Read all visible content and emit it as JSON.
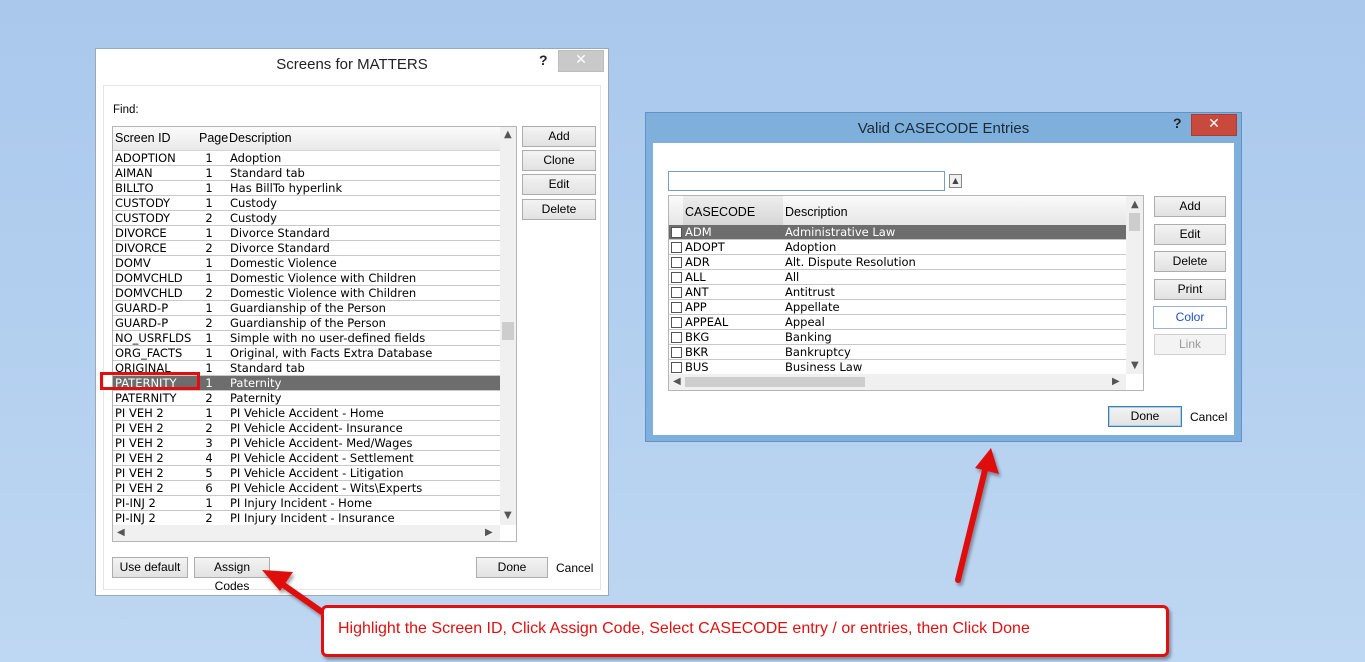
{
  "screens_dialog": {
    "title": "Screens for MATTERS",
    "help": "?",
    "close": "✕",
    "find_label": "Find:",
    "columns": [
      "Screen ID",
      "Page",
      "Description"
    ],
    "rows": [
      {
        "id": "ADOPTION",
        "page": "1",
        "desc": "Adoption"
      },
      {
        "id": "AIMAN",
        "page": "1",
        "desc": "Standard tab"
      },
      {
        "id": "BILLTO",
        "page": "1",
        "desc": "Has BillTo hyperlink"
      },
      {
        "id": "CUSTODY",
        "page": "1",
        "desc": "Custody"
      },
      {
        "id": "CUSTODY",
        "page": "2",
        "desc": "Custody"
      },
      {
        "id": "DIVORCE",
        "page": "1",
        "desc": "Divorce Standard"
      },
      {
        "id": "DIVORCE",
        "page": "2",
        "desc": "Divorce Standard"
      },
      {
        "id": "DOMV",
        "page": "1",
        "desc": "Domestic Violence"
      },
      {
        "id": "DOMVCHLD",
        "page": "1",
        "desc": "Domestic Violence with Children"
      },
      {
        "id": "DOMVCHLD",
        "page": "2",
        "desc": "Domestic Violence with Children"
      },
      {
        "id": "GUARD-P",
        "page": "1",
        "desc": "Guardianship of the Person"
      },
      {
        "id": "GUARD-P",
        "page": "2",
        "desc": "Guardianship of the Person"
      },
      {
        "id": "NO_USRFLDS",
        "page": "1",
        "desc": "Simple with no user-defined fields"
      },
      {
        "id": "ORG_FACTS",
        "page": "1",
        "desc": "Original, with Facts Extra Database"
      },
      {
        "id": "ORIGINAL",
        "page": "1",
        "desc": "Standard tab"
      },
      {
        "id": "PATERNITY",
        "page": "1",
        "desc": "Paternity",
        "selected": true
      },
      {
        "id": "PATERNITY",
        "page": "2",
        "desc": "Paternity"
      },
      {
        "id": "PI VEH 2",
        "page": "1",
        "desc": "PI Vehicle Accident - Home"
      },
      {
        "id": "PI VEH 2",
        "page": "2",
        "desc": "PI Vehicle Accident- Insurance"
      },
      {
        "id": "PI VEH 2",
        "page": "3",
        "desc": "PI Vehicle Accident- Med/Wages"
      },
      {
        "id": "PI VEH 2",
        "page": "4",
        "desc": "PI Vehicle Accident - Settlement"
      },
      {
        "id": "PI VEH 2",
        "page": "5",
        "desc": "PI Vehicle Accident - Litigation"
      },
      {
        "id": "PI VEH 2",
        "page": "6",
        "desc": "PI Vehicle Accident - Wits\\Experts"
      },
      {
        "id": "PI-INJ 2",
        "page": "1",
        "desc": "PI Injury Incident - Home"
      },
      {
        "id": "PI-INJ 2",
        "page": "2",
        "desc": "PI Injury Incident - Insurance"
      }
    ],
    "side_buttons": [
      "Add",
      "Clone",
      "Edit",
      "Delete"
    ],
    "use_default": "Use default",
    "assign_codes": "Assign Codes",
    "done": "Done",
    "cancel": "Cancel"
  },
  "casecode_dialog": {
    "title": "Valid CASECODE Entries",
    "help": "?",
    "close": "✕",
    "search_value": "",
    "columns": [
      "CASECODE",
      "Description"
    ],
    "rows": [
      {
        "code": "ADM",
        "desc": "Administrative Law",
        "selected": true
      },
      {
        "code": "ADOPT",
        "desc": "Adoption"
      },
      {
        "code": "ADR",
        "desc": "Alt. Dispute Resolution"
      },
      {
        "code": "ALL",
        "desc": "All"
      },
      {
        "code": "ANT",
        "desc": "Antitrust"
      },
      {
        "code": "APP",
        "desc": "Appellate"
      },
      {
        "code": "APPEAL",
        "desc": "Appeal"
      },
      {
        "code": "BKG",
        "desc": "Banking"
      },
      {
        "code": "BKR",
        "desc": "Bankruptcy"
      },
      {
        "code": "BUS",
        "desc": "Business Law"
      }
    ],
    "side_buttons": {
      "add": "Add",
      "edit": "Edit",
      "delete": "Delete",
      "print": "Print",
      "color": "Color",
      "link": "Link"
    },
    "done": "Done",
    "cancel": "Cancel"
  },
  "callout_text": "Highlight the Screen ID, Click Assign Code, Select CASECODE entry / or entries, then Click Done",
  "colors": {
    "accent_red": "#e01010",
    "selection": "#6d6d6d",
    "link_blue": "#1f4fbf"
  }
}
